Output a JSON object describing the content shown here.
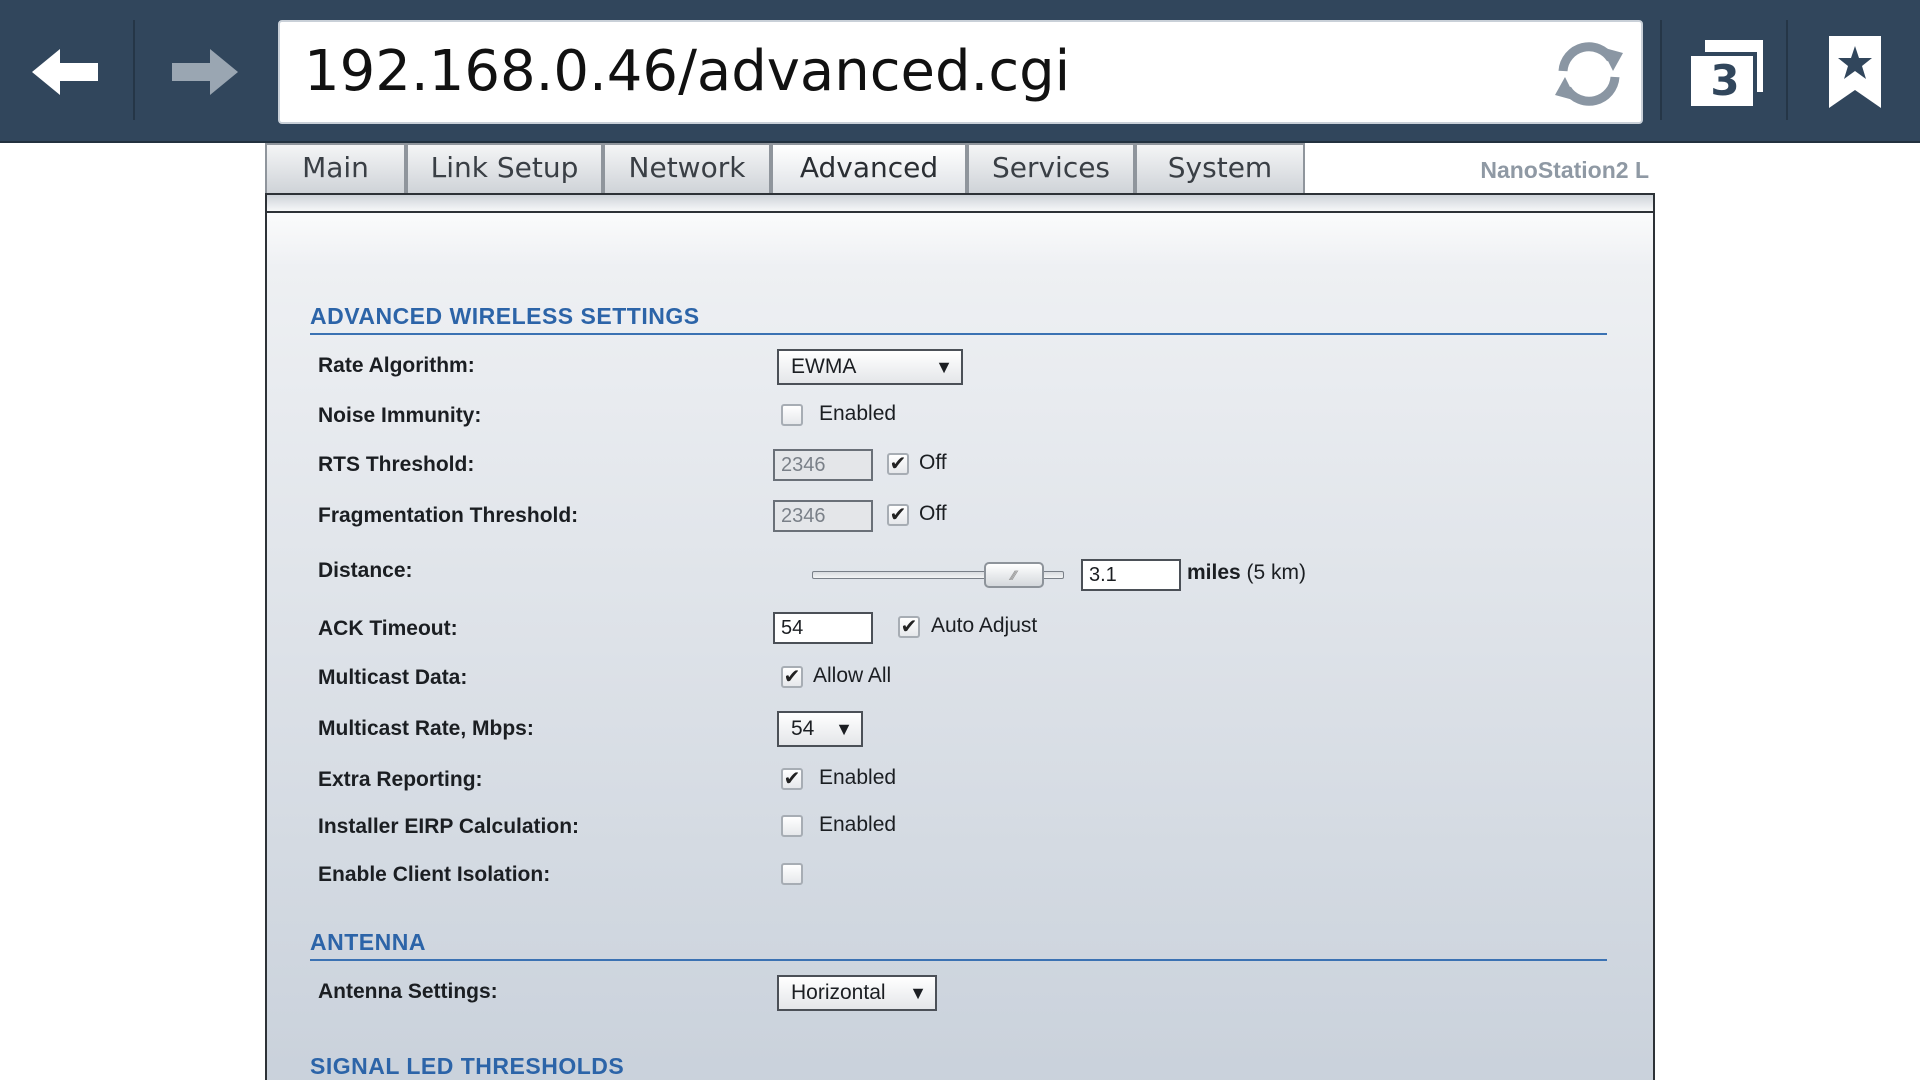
{
  "browser": {
    "url": "192.168.0.46/advanced.cgi",
    "tab_count": "3"
  },
  "device_name": "NanoStation2 L",
  "tabs": [
    {
      "label": "Main"
    },
    {
      "label": "Link Setup"
    },
    {
      "label": "Network"
    },
    {
      "label": "Advanced"
    },
    {
      "label": "Services"
    },
    {
      "label": "System"
    }
  ],
  "sections": {
    "wireless": {
      "title": "ADVANCED WIRELESS SETTINGS"
    },
    "antenna": {
      "title": "ANTENNA"
    },
    "signal": {
      "title": "SIGNAL LED THRESHOLDS"
    }
  },
  "fields": {
    "rate_algorithm": {
      "label": "Rate Algorithm:",
      "value": "EWMA"
    },
    "noise_immunity": {
      "label": "Noise Immunity:",
      "option": "Enabled",
      "checked": false
    },
    "rts_threshold": {
      "label": "RTS Threshold:",
      "value": "2346",
      "option": "Off",
      "checked": true
    },
    "fragmentation_threshold": {
      "label": "Fragmentation Threshold:",
      "value": "2346",
      "option": "Off",
      "checked": true
    },
    "distance": {
      "label": "Distance:",
      "value": "3.1",
      "unit": "miles",
      "km": "(5 km)",
      "slider_fraction": 0.8
    },
    "ack_timeout": {
      "label": "ACK Timeout:",
      "value": "54",
      "option": "Auto Adjust",
      "checked": true
    },
    "multicast_data": {
      "label": "Multicast Data:",
      "option": "Allow All",
      "checked": true
    },
    "multicast_rate": {
      "label": "Multicast Rate, Mbps:",
      "value": "54"
    },
    "extra_reporting": {
      "label": "Extra Reporting:",
      "option": "Enabled",
      "checked": true
    },
    "installer_eirp": {
      "label": "Installer EIRP Calculation:",
      "option": "Enabled",
      "checked": false
    },
    "client_isolation": {
      "label": "Enable Client Isolation:",
      "checked": false
    },
    "antenna_settings": {
      "label": "Antenna Settings:",
      "value": "Horizontal"
    }
  },
  "glyphs": {
    "check": "✔",
    "dropdown": "▼",
    "slider_grip": "⁄⁄⁄"
  },
  "colors": {
    "chrome": "#31465c",
    "section_title": "#2c64a8"
  }
}
